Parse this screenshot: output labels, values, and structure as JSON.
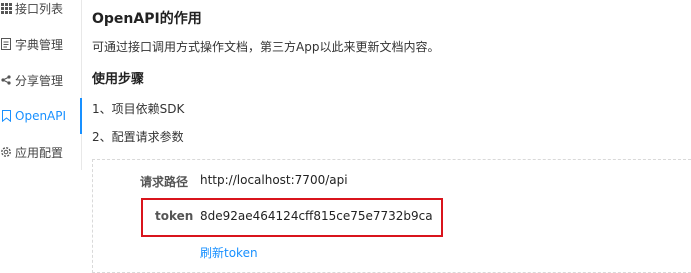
{
  "sidebar": {
    "items": [
      {
        "label": "接口列表",
        "icon": "list-icon",
        "active": false
      },
      {
        "label": "字典管理",
        "icon": "document-icon",
        "active": false
      },
      {
        "label": "分享管理",
        "icon": "share-icon",
        "active": false
      },
      {
        "label": "OpenAPI",
        "icon": "bookmark-icon",
        "active": true
      },
      {
        "label": "应用配置",
        "icon": "gear-icon",
        "active": false
      }
    ]
  },
  "main": {
    "title": "OpenAPI的作用",
    "description": "可通过接口调用方式操作文档，第三方App以此来更新文档内容。",
    "steps_title": "使用步骤",
    "steps": [
      "1、项目依赖SDK",
      "2、配置请求参数"
    ]
  },
  "panel": {
    "request_path_label": "请求路径",
    "request_path_value": "http://localhost:7700/api",
    "token_label": "token",
    "token_value": "8de92ae464124cff815ce75e7732b9ca",
    "refresh_label": "刷新token"
  },
  "colors": {
    "accent": "#1890ff",
    "highlight_border": "#d9141c",
    "text": "#333333"
  }
}
